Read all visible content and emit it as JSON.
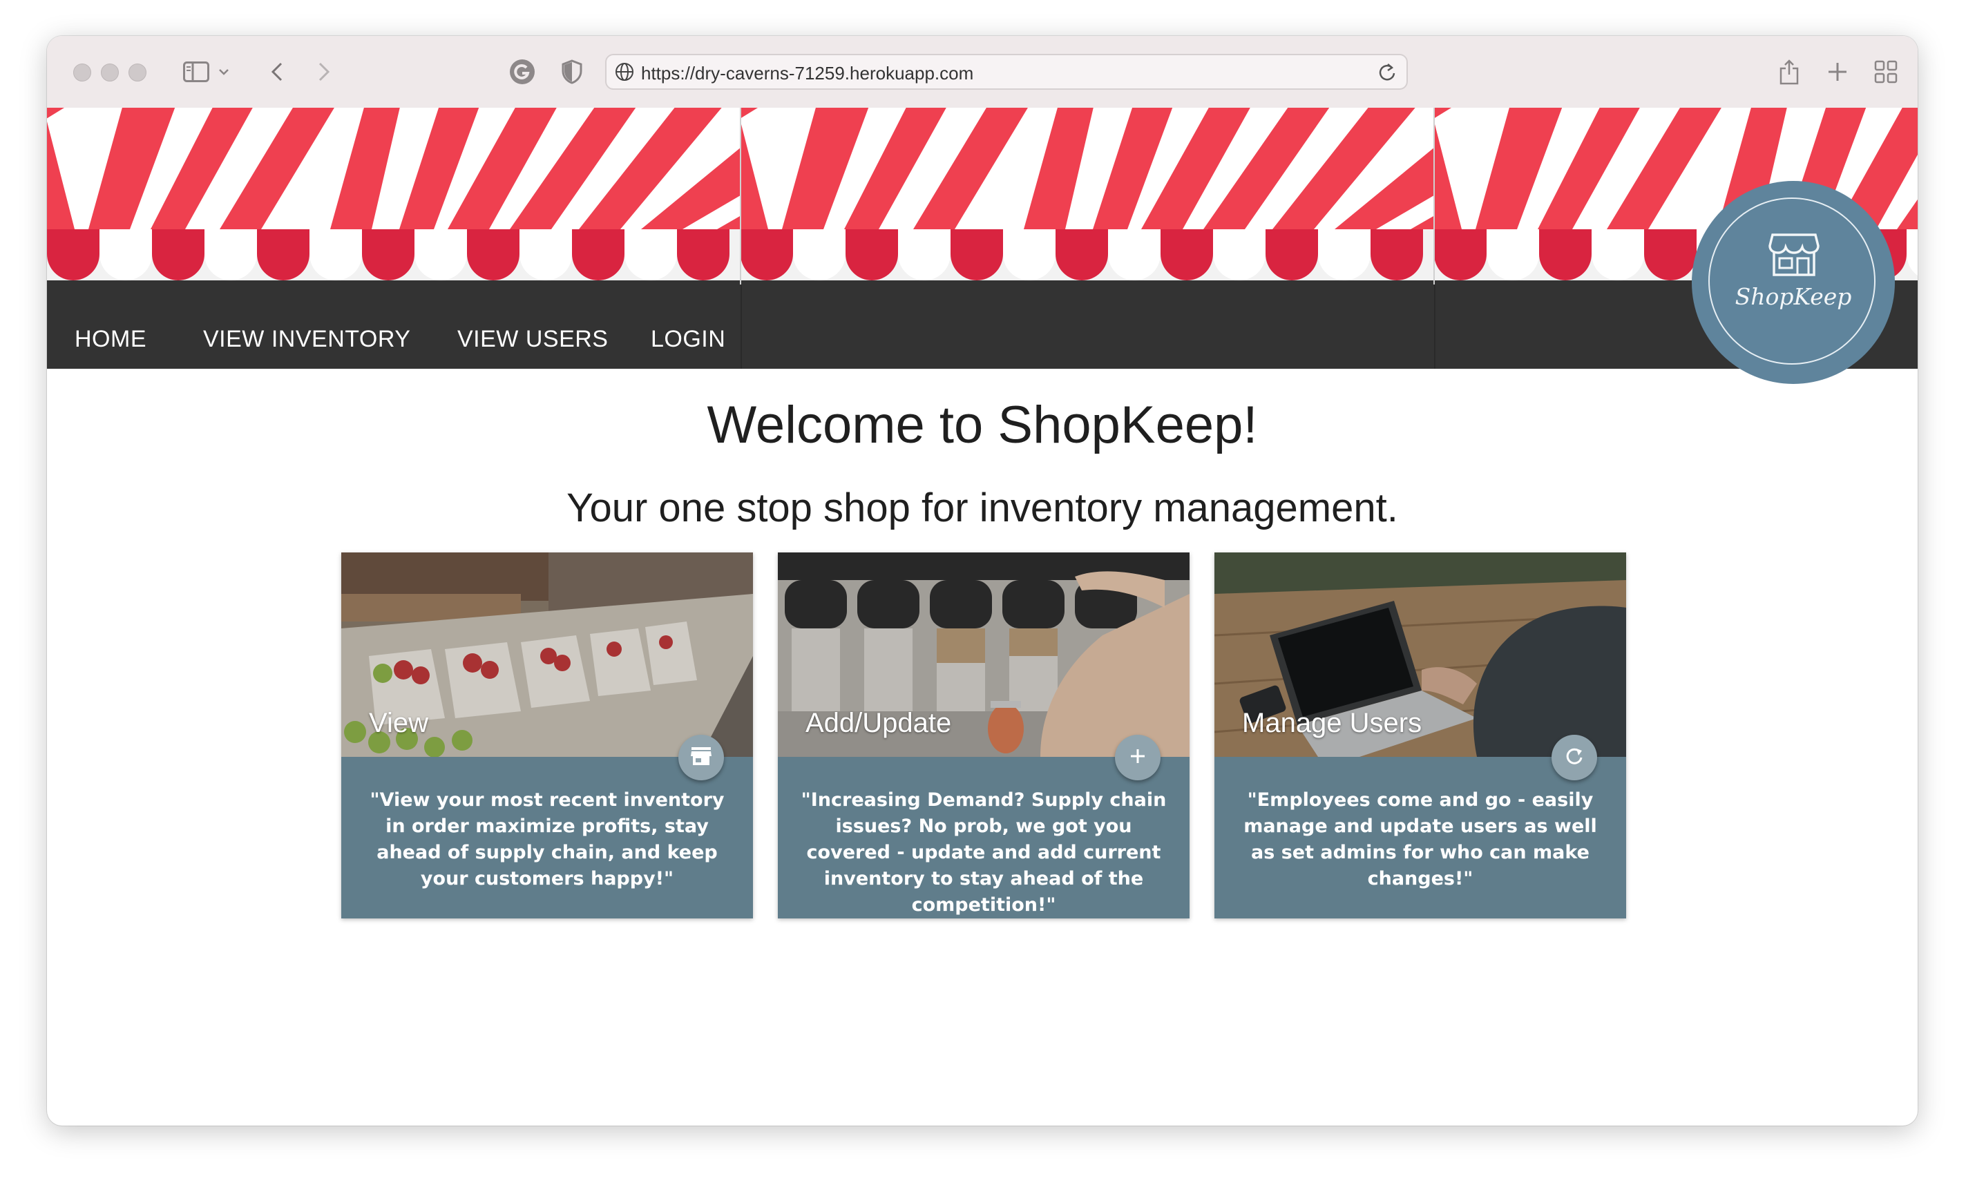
{
  "browser": {
    "url": "https://dry-caverns-71259.herokuapp.com"
  },
  "nav": {
    "items": [
      "HOME",
      "VIEW INVENTORY",
      "VIEW USERS",
      "LOGIN"
    ]
  },
  "logo": {
    "text": "ShopKeep"
  },
  "main": {
    "title": "Welcome to ShopKeep!",
    "subtitle": "Your one stop shop for inventory management."
  },
  "cards": [
    {
      "title": "View",
      "icon": "store-icon",
      "text": "\"View your most recent inventory in order maximize profits, stay ahead of supply chain, and keep your customers happy!\""
    },
    {
      "title": "Add/Update",
      "icon": "plus-icon",
      "text": "\"Increasing Demand? Supply chain issues? No prob, we got you covered - update and add current inventory to stay ahead of the competition!\""
    },
    {
      "title": "Manage Users",
      "icon": "refresh-icon",
      "text": "\"Employees come and go - easily manage and update users as well as set admins for who can make changes!\""
    }
  ],
  "colors": {
    "awning_red": "#ef4050",
    "awning_dark_red": "#d92440",
    "navbar": "#333333",
    "card": "#607d8b",
    "logo": "#5f849c"
  }
}
